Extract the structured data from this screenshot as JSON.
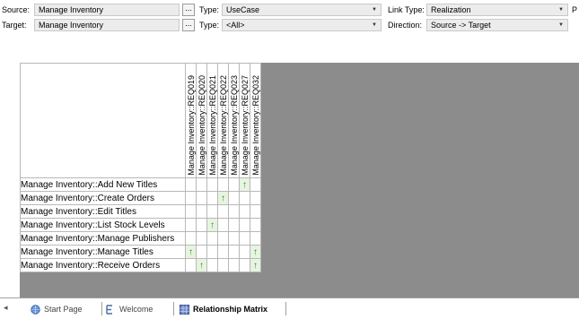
{
  "toolbar": {
    "source_label": "Source:",
    "source_value": "Manage Inventory",
    "target_label": "Target:",
    "target_value": "Manage Inventory",
    "browse_label": "...",
    "source_type_label": "Type:",
    "source_type_value": "UseCase",
    "target_type_label": "Type:",
    "target_type_value": "<All>",
    "link_type_label": "Link Type:",
    "link_type_value": "Realization",
    "direction_label": "Direction:",
    "direction_value": "Source -> Target",
    "cut_label": "P"
  },
  "matrix": {
    "columns": [
      "Manage Inventory::REQ019",
      "Manage Inventory::REQ020",
      "Manage Inventory::REQ021",
      "Manage Inventory::REQ022",
      "Manage Inventory::REQ023",
      "Manage Inventory::REQ027",
      "Manage Inventory::REQ032"
    ],
    "rows": [
      {
        "label": "Manage Inventory::Add New Titles",
        "marks": [
          0,
          0,
          0,
          0,
          0,
          1,
          0
        ]
      },
      {
        "label": "Manage Inventory::Create Orders",
        "marks": [
          0,
          0,
          0,
          1,
          0,
          0,
          0
        ]
      },
      {
        "label": "Manage Inventory::Edit Titles",
        "marks": [
          0,
          0,
          0,
          0,
          0,
          0,
          0
        ]
      },
      {
        "label": "Manage Inventory::List Stock Levels",
        "marks": [
          0,
          0,
          1,
          0,
          0,
          0,
          0
        ]
      },
      {
        "label": "Manage Inventory::Manage Publishers",
        "marks": [
          0,
          0,
          0,
          0,
          0,
          0,
          0
        ]
      },
      {
        "label": "Manage Inventory::Manage Titles",
        "marks": [
          1,
          0,
          0,
          0,
          0,
          0,
          1
        ]
      },
      {
        "label": "Manage Inventory::Receive Orders",
        "marks": [
          0,
          1,
          0,
          0,
          0,
          0,
          1
        ]
      }
    ],
    "mark_icon": "arrow-up-icon",
    "mark_color": "#3d7f2c"
  },
  "tabs": {
    "nav_label": "◂",
    "items": [
      {
        "label": "Start Page",
        "icon": "globe-icon",
        "active": false
      },
      {
        "label": "Welcome",
        "icon": "ea-app-icon",
        "active": false
      },
      {
        "label": "Relationship Matrix",
        "icon": "matrix-icon",
        "active": true
      }
    ]
  }
}
